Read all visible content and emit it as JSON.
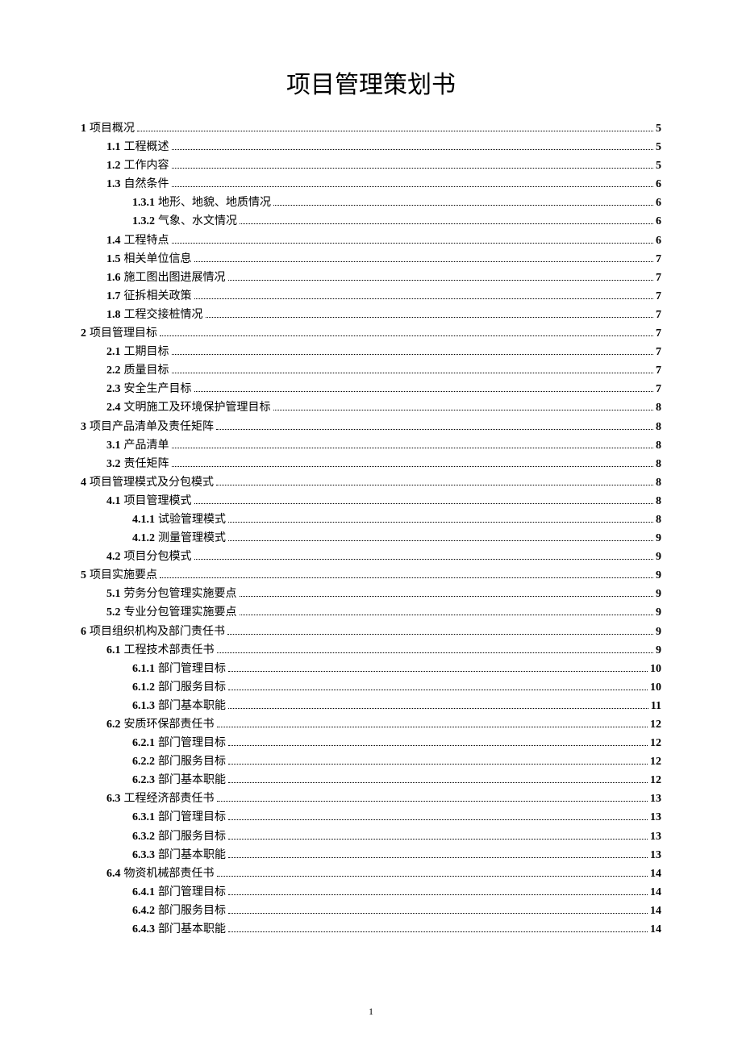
{
  "title": "项目管理策划书",
  "page_number": "1",
  "toc": [
    {
      "level": 1,
      "num": "1",
      "label": "项目概况",
      "page": "5"
    },
    {
      "level": 2,
      "num": "1.1",
      "label": "工程概述",
      "page": "5"
    },
    {
      "level": 2,
      "num": "1.2",
      "label": "工作内容",
      "page": "5"
    },
    {
      "level": 2,
      "num": "1.3",
      "label": "自然条件",
      "page": "6"
    },
    {
      "level": 3,
      "num": "1.3.1",
      "label": "地形、地貌、地质情况",
      "page": "6"
    },
    {
      "level": 3,
      "num": "1.3.2",
      "label": "气象、水文情况",
      "page": "6"
    },
    {
      "level": 2,
      "num": "1.4",
      "label": "工程特点",
      "page": "6"
    },
    {
      "level": 2,
      "num": "1.5",
      "label": "相关单位信息",
      "page": "7"
    },
    {
      "level": 2,
      "num": "1.6",
      "label": "施工图出图进展情况",
      "page": "7"
    },
    {
      "level": 2,
      "num": "1.7",
      "label": "征拆相关政策",
      "page": "7"
    },
    {
      "level": 2,
      "num": "1.8",
      "label": "工程交接桩情况",
      "page": "7"
    },
    {
      "level": 1,
      "num": "2",
      "label": "项目管理目标",
      "page": "7"
    },
    {
      "level": 2,
      "num": "2.1",
      "label": "工期目标",
      "page": "7"
    },
    {
      "level": 2,
      "num": "2.2",
      "label": "质量目标",
      "page": "7"
    },
    {
      "level": 2,
      "num": "2.3",
      "label": "安全生产目标",
      "page": "7"
    },
    {
      "level": 2,
      "num": "2.4",
      "label": "文明施工及环境保护管理目标",
      "page": "8"
    },
    {
      "level": 1,
      "num": "3",
      "label": "项目产品清单及责任矩阵",
      "page": "8"
    },
    {
      "level": 2,
      "num": "3.1",
      "label": "产品清单",
      "page": "8"
    },
    {
      "level": 2,
      "num": "3.2",
      "label": "责任矩阵",
      "page": "8"
    },
    {
      "level": 1,
      "num": "4",
      "label": "项目管理模式及分包模式",
      "page": "8"
    },
    {
      "level": 2,
      "num": "4.1",
      "label": "项目管理模式",
      "page": "8"
    },
    {
      "level": 3,
      "num": "4.1.1",
      "label": "试验管理模式",
      "page": "8"
    },
    {
      "level": 3,
      "num": "4.1.2",
      "label": "测量管理模式",
      "page": "9"
    },
    {
      "level": 2,
      "num": "4.2",
      "label": "项目分包模式",
      "page": "9"
    },
    {
      "level": 1,
      "num": "5",
      "label": "项目实施要点",
      "page": "9"
    },
    {
      "level": 2,
      "num": "5.1",
      "label": "劳务分包管理实施要点",
      "page": "9"
    },
    {
      "level": 2,
      "num": "5.2",
      "label": "专业分包管理实施要点",
      "page": "9"
    },
    {
      "level": 1,
      "num": "6",
      "label": "项目组织机构及部门责任书",
      "page": "9"
    },
    {
      "level": 2,
      "num": "6.1",
      "label": "工程技术部责任书",
      "page": "9"
    },
    {
      "level": 3,
      "num": "6.1.1",
      "label": "部门管理目标",
      "page": "10"
    },
    {
      "level": 3,
      "num": "6.1.2",
      "label": "部门服务目标",
      "page": "10"
    },
    {
      "level": 3,
      "num": "6.1.3",
      "label": "部门基本职能",
      "page": "11"
    },
    {
      "level": 2,
      "num": "6.2",
      "label": "安质环保部责任书",
      "page": "12"
    },
    {
      "level": 3,
      "num": "6.2.1",
      "label": "部门管理目标",
      "page": "12"
    },
    {
      "level": 3,
      "num": "6.2.2",
      "label": "部门服务目标",
      "page": "12"
    },
    {
      "level": 3,
      "num": "6.2.3",
      "label": "部门基本职能",
      "page": "12"
    },
    {
      "level": 2,
      "num": "6.3",
      "label": "工程经济部责任书",
      "page": "13"
    },
    {
      "level": 3,
      "num": "6.3.1",
      "label": "部门管理目标",
      "page": "13"
    },
    {
      "level": 3,
      "num": "6.3.2",
      "label": "部门服务目标",
      "page": "13"
    },
    {
      "level": 3,
      "num": "6.3.3",
      "label": "部门基本职能",
      "page": "13"
    },
    {
      "level": 2,
      "num": "6.4",
      "label": "物资机械部责任书",
      "page": "14"
    },
    {
      "level": 3,
      "num": "6.4.1",
      "label": "部门管理目标",
      "page": "14"
    },
    {
      "level": 3,
      "num": "6.4.2",
      "label": "部门服务目标",
      "page": "14"
    },
    {
      "level": 3,
      "num": "6.4.3",
      "label": "部门基本职能",
      "page": "14"
    }
  ]
}
